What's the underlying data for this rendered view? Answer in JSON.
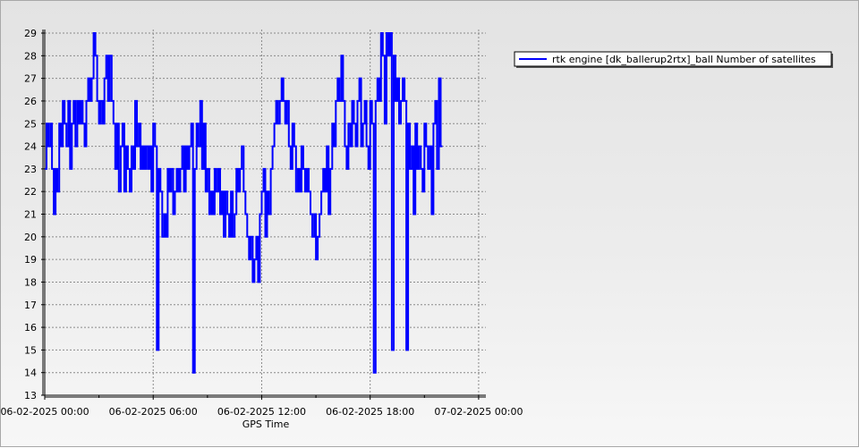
{
  "chart_data": {
    "type": "line",
    "title": "",
    "xlabel": "GPS Time",
    "ylabel": "",
    "x_ticks": [
      "06-02-2025 00:00",
      "06-02-2025 06:00",
      "06-02-2025 12:00",
      "06-02-2025 18:00",
      "07-02-2025 00:00"
    ],
    "x_tick_hours": [
      0,
      6,
      12,
      18,
      24
    ],
    "xlim_hours": [
      0,
      24.4
    ],
    "ylim": [
      13,
      29
    ],
    "y_ticks": [
      13,
      14,
      15,
      16,
      17,
      18,
      19,
      20,
      21,
      22,
      23,
      24,
      25,
      26,
      27,
      28,
      29
    ],
    "grid": true,
    "legend_position": "top-right",
    "series": [
      {
        "name": "rtk engine [dk_ballerup2rtx]_ball Number of satellites",
        "color": "#0000ff",
        "hours": [
          0.0,
          0.1,
          0.2,
          0.3,
          0.4,
          0.5,
          0.6,
          0.7,
          0.8,
          0.9,
          1.0,
          1.1,
          1.2,
          1.3,
          1.4,
          1.5,
          1.6,
          1.7,
          1.8,
          1.9,
          2.0,
          2.1,
          2.2,
          2.3,
          2.4,
          2.5,
          2.6,
          2.7,
          2.8,
          2.9,
          3.0,
          3.1,
          3.2,
          3.3,
          3.4,
          3.5,
          3.6,
          3.7,
          3.8,
          3.9,
          4.0,
          4.1,
          4.2,
          4.3,
          4.4,
          4.5,
          4.6,
          4.7,
          4.8,
          4.9,
          5.0,
          5.1,
          5.2,
          5.3,
          5.4,
          5.5,
          5.6,
          5.7,
          5.8,
          5.9,
          6.0,
          6.1,
          6.2,
          6.3,
          6.4,
          6.5,
          6.6,
          6.7,
          6.8,
          6.9,
          7.0,
          7.1,
          7.2,
          7.3,
          7.4,
          7.5,
          7.6,
          7.7,
          7.8,
          7.9,
          8.0,
          8.1,
          8.2,
          8.3,
          8.4,
          8.5,
          8.6,
          8.7,
          8.8,
          8.9,
          9.0,
          9.1,
          9.2,
          9.3,
          9.4,
          9.5,
          9.6,
          9.7,
          9.8,
          9.9,
          10.0,
          10.1,
          10.2,
          10.3,
          10.4,
          10.5,
          10.6,
          10.7,
          10.8,
          10.9,
          11.0,
          11.1,
          11.2,
          11.3,
          11.4,
          11.5,
          11.6,
          11.7,
          11.8,
          11.9,
          12.0,
          12.1,
          12.2,
          12.3,
          12.4,
          12.5,
          12.6,
          12.7,
          12.8,
          12.9,
          13.0,
          13.1,
          13.2,
          13.3,
          13.4,
          13.5,
          13.6,
          13.7,
          13.8,
          13.9,
          14.0,
          14.1,
          14.2,
          14.3,
          14.4,
          14.5,
          14.6,
          14.7,
          14.8,
          14.9,
          15.0,
          15.1,
          15.2,
          15.3,
          15.4,
          15.5,
          15.6,
          15.7,
          15.8,
          15.9,
          16.0,
          16.1,
          16.2,
          16.3,
          16.4,
          16.5,
          16.6,
          16.7,
          16.8,
          16.9,
          17.0,
          17.1,
          17.2,
          17.3,
          17.4,
          17.5,
          17.6,
          17.7,
          17.8,
          17.9,
          18.0,
          18.1,
          18.2,
          18.3,
          18.4,
          18.5,
          18.6,
          18.7,
          18.8,
          18.9,
          19.0,
          19.1,
          19.2,
          19.3,
          19.4,
          19.5,
          19.6,
          19.7,
          19.8,
          19.9,
          20.0,
          20.1,
          20.2,
          20.3,
          20.4,
          20.5,
          20.6,
          20.7,
          20.8,
          20.9,
          21.0,
          21.1,
          21.2,
          21.3,
          21.4,
          21.5,
          21.6,
          21.7,
          21.8,
          21.9,
          22.0,
          22.1,
          22.2,
          22.3,
          22.4,
          22.5,
          22.6,
          22.7,
          22.8,
          22.9,
          23.0,
          23.1,
          23.2,
          23.3,
          23.4,
          23.5,
          23.6,
          23.7,
          23.8,
          23.9,
          24.0,
          24.1,
          24.2,
          24.3,
          24.4
        ],
        "values": [
          23,
          25,
          24,
          25,
          23,
          21,
          23,
          22,
          25,
          24,
          26,
          25,
          24,
          26,
          23,
          25,
          26,
          24,
          26,
          25,
          26,
          25,
          24,
          26,
          27,
          26,
          27,
          29,
          28,
          26,
          25,
          26,
          25,
          27,
          28,
          26,
          28,
          26,
          25,
          23,
          25,
          22,
          24,
          25,
          22,
          24,
          23,
          22,
          24,
          23,
          26,
          24,
          25,
          23,
          24,
          23,
          24,
          23,
          24,
          22,
          25,
          24,
          15,
          23,
          22,
          20,
          21,
          20,
          23,
          22,
          23,
          21,
          22,
          23,
          22,
          23,
          24,
          22,
          24,
          23,
          24,
          25,
          14,
          23,
          25,
          24,
          26,
          23,
          25,
          22,
          23,
          21,
          22,
          21,
          23,
          22,
          23,
          21,
          22,
          20,
          22,
          21,
          20,
          22,
          20,
          21,
          23,
          22,
          23,
          24,
          22,
          21,
          20,
          19,
          20,
          18,
          19,
          20,
          18,
          21,
          22,
          23,
          20,
          22,
          21,
          23,
          24,
          25,
          26,
          25,
          26,
          27,
          26,
          25,
          26,
          24,
          23,
          25,
          24,
          22,
          23,
          22,
          24,
          23,
          22,
          23,
          22,
          21,
          20,
          21,
          19,
          20,
          21,
          22,
          23,
          22,
          24,
          21,
          23,
          25,
          24,
          26,
          27,
          26,
          28,
          26,
          24,
          23,
          25,
          24,
          26,
          25,
          24,
          26,
          27,
          24,
          25,
          26,
          24,
          23,
          26,
          25,
          14,
          26,
          27,
          26,
          29,
          28,
          25,
          29,
          28,
          29,
          15,
          28,
          26,
          27,
          25,
          26,
          27,
          26,
          15,
          25,
          23,
          24,
          21,
          25,
          23,
          24,
          23,
          22,
          25,
          24,
          23,
          24,
          21,
          25,
          26,
          23,
          27,
          24
        ]
      }
    ]
  }
}
